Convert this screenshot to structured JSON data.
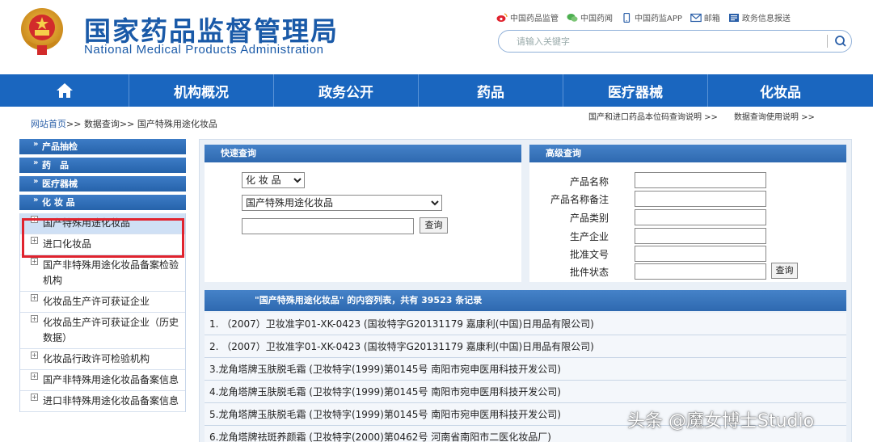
{
  "header": {
    "title": "国家药品监督管理局",
    "subtitle": "National Medical Products Administration",
    "quick_links": [
      {
        "label": "中国药品监管",
        "icon": "weibo-icon"
      },
      {
        "label": "中国药闻",
        "icon": "wechat-icon"
      },
      {
        "label": "中国药监APP",
        "icon": "mobile-icon"
      },
      {
        "label": "邮箱",
        "icon": "mail-icon"
      },
      {
        "label": "政务信息报送",
        "icon": "report-icon"
      }
    ],
    "search_placeholder": "请输入关键字"
  },
  "nav": {
    "home_icon": "home-icon",
    "items": [
      "机构概况",
      "政务公开",
      "药品",
      "医疗器械",
      "化妆品"
    ]
  },
  "breadcrumb": {
    "home": "网站首页",
    "sep": ">>",
    "level2": "数据查询",
    "level3": "国产特殊用途化妆品"
  },
  "top_links": [
    "国产和进口药品本位码查询说明 >>",
    "数据查询使用说明 >>"
  ],
  "sidebar": {
    "headers": [
      "产品抽检",
      "药　品",
      "医疗器械",
      "化 妆 品"
    ],
    "items": [
      "国产特殊用途化妆品",
      "进口化妆品",
      "国产非特殊用途化妆品备案检验机构",
      "化妆品生产许可获证企业",
      "化妆品生产许可获证企业（历史数据）",
      "化妆品行政许可检验机构",
      "国产非特殊用途化妆品备案信息",
      "进口非特殊用途化妆品备案信息"
    ]
  },
  "quick_search": {
    "title": "快速查询",
    "category_value": "化 妆 品",
    "subcategory_value": "国产特殊用途化妆品",
    "button": "查询"
  },
  "advanced_search": {
    "title": "高级查询",
    "fields": [
      "产品名称",
      "产品名称备注",
      "产品类别",
      "生产企业",
      "批准文号",
      "批件状态"
    ],
    "button": "查询"
  },
  "results": {
    "summary": "\"国产特殊用途化妆品\" 的内容列表，共有  39523  条记录",
    "rows": [
      "1. （2007）卫妆准字01-XK-0423 (国妆特字G20131179 嘉康利(中国)日用品有限公司)",
      "2. （2007）卫妆准字01-XK-0423 (国妆特字G20131179 嘉康利(中国)日用品有限公司)",
      "3.龙角塔牌玉肤脱毛霜 (卫妆特字(1999)第0145号 南阳市宛申医用科技开发公司)",
      "4.龙角塔牌玉肤脱毛霜 (卫妆特字(1999)第0145号 南阳市宛申医用科技开发公司)",
      "5.龙角塔牌玉肤脱毛霜 (卫妆特字(1999)第0145号 南阳市宛申医用科技开发公司)",
      "6.龙角塔牌祛斑养颜霜 (卫妆特字(2000)第0462号 河南省南阳市二医化妆品厂)"
    ]
  },
  "watermark": "头条 @魔女博士Studio",
  "colors": {
    "brand_blue": "#1a66bf",
    "title_blue": "#1a5aa8",
    "highlight_red": "#e0232e"
  }
}
